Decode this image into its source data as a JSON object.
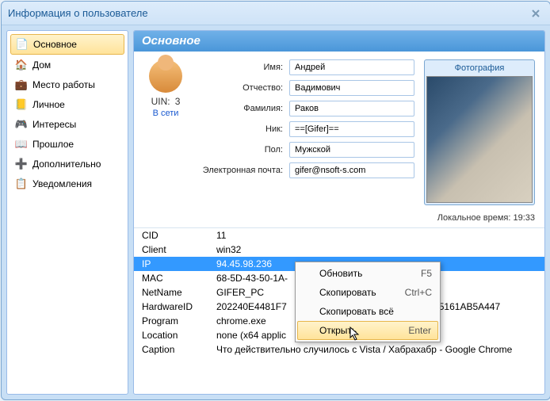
{
  "window": {
    "title": "Информация о пользователе"
  },
  "sidebar": {
    "items": [
      {
        "label": "Основное",
        "icon": "📄"
      },
      {
        "label": "Дом",
        "icon": "🏠"
      },
      {
        "label": "Место работы",
        "icon": "💼"
      },
      {
        "label": "Личное",
        "icon": "📒"
      },
      {
        "label": "Интересы",
        "icon": "🎮"
      },
      {
        "label": "Прошлое",
        "icon": "📖"
      },
      {
        "label": "Дополнительно",
        "icon": "➕"
      },
      {
        "label": "Уведомления",
        "icon": "📋"
      }
    ]
  },
  "main": {
    "header": "Основное",
    "uin_label": "UIN:",
    "uin_value": "3",
    "status": "В сети",
    "fields": {
      "name_label": "Имя:",
      "name_value": "Андрей",
      "patronymic_label": "Отчество:",
      "patronymic_value": "Вадимович",
      "surname_label": "Фамилия:",
      "surname_value": "Раков",
      "nick_label": "Ник:",
      "nick_value": "==[Gifer]==",
      "gender_label": "Пол:",
      "gender_value": "Мужской",
      "email_label": "Электронная почта:",
      "email_value": "gifer@nsoft-s.com"
    },
    "photo_title": "Фотография",
    "local_time": "Локальное время: 19:33"
  },
  "grid": [
    {
      "k": "CID",
      "v": "11"
    },
    {
      "k": "Client",
      "v": "win32"
    },
    {
      "k": "IP",
      "v": "94.45.98.236",
      "sel": true
    },
    {
      "k": "MAC",
      "v": "68-5D-43-50-1A-"
    },
    {
      "k": "NetName",
      "v": "GIFER_PC"
    },
    {
      "k": "HardwareID",
      "v": "202240E4481F7"
    },
    {
      "k": "Program",
      "v": "chrome.exe"
    },
    {
      "k": "Location",
      "v": "none (x64 applic"
    },
    {
      "k": "Caption",
      "v": "Что действительно случилось с Vista / Хабрахабр - Google Chrome"
    }
  ],
  "grid_tail": "5161AB5A447",
  "context_menu": {
    "items": [
      {
        "label": "Обновить",
        "shortcut": "F5"
      },
      {
        "label": "Скопировать",
        "shortcut": "Ctrl+C"
      },
      {
        "label": "Скопировать всё",
        "shortcut": ""
      },
      {
        "label": "Открыть",
        "shortcut": "Enter",
        "sel": true
      }
    ]
  }
}
